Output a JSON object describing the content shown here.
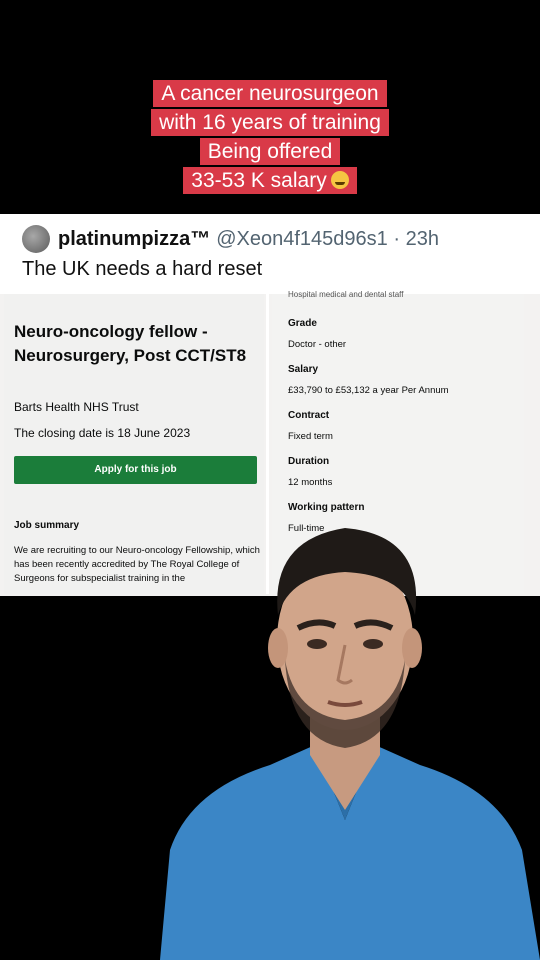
{
  "caption": {
    "lines": [
      "A cancer neurosurgeon",
      "with 16 years of training",
      "Being offered",
      "33-53 K salary"
    ],
    "emoji": "crying-face-emoji"
  },
  "tweet": {
    "display_name": "platinumpizza™",
    "handle": "@Xeon4f145d96s1",
    "time": "· 23h",
    "text": "The UK needs a hard reset"
  },
  "job": {
    "title": "Neuro-oncology fellow - Neurosurgery, Post CCT/ST8",
    "employer": "Barts Health NHS Trust",
    "closing_date": "The closing date is 18 June 2023",
    "apply_label": "Apply for this job",
    "summary_heading": "Job summary",
    "summary_text": "We are recruiting to our Neuro-oncology Fellowship, which has been recently accredited by The Royal College of Surgeons for subspecialist training in the",
    "top_cut_text": "Hospital medical and dental staff",
    "fields": [
      {
        "label": "Grade",
        "value": "Doctor - other"
      },
      {
        "label": "Salary",
        "value": "£33,790 to £53,132 a year Per Annum"
      },
      {
        "label": "Contract",
        "value": "Fixed term"
      },
      {
        "label": "Duration",
        "value": "12 months"
      },
      {
        "label": "Working pattern",
        "value": "Full-time"
      }
    ]
  },
  "colors": {
    "caption_bg": "#d93a48",
    "apply_button": "#1b7d3a",
    "scrubs": "#3b86c6"
  }
}
